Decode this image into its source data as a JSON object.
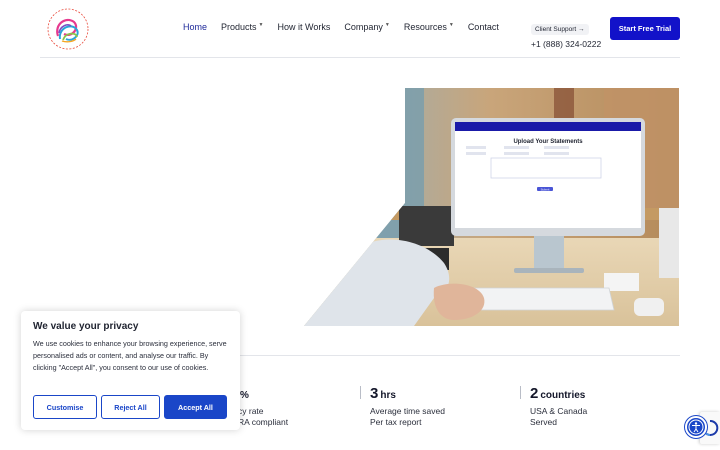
{
  "nav": {
    "items": [
      {
        "label": "Home",
        "has_dropdown": false,
        "active": true
      },
      {
        "label": "Products",
        "has_dropdown": true,
        "active": false
      },
      {
        "label": "How it Works",
        "has_dropdown": false,
        "active": false
      },
      {
        "label": "Company",
        "has_dropdown": true,
        "active": false
      },
      {
        "label": "Resources",
        "has_dropdown": true,
        "active": false
      },
      {
        "label": "Contact",
        "has_dropdown": false,
        "active": false
      }
    ]
  },
  "support": {
    "label": "Client Support",
    "arrow": "→",
    "phone": "+1 (888) 324-0222"
  },
  "cta": {
    "label": "Start Free Trial"
  },
  "hero_screen": {
    "heading": "Upload Your Statements",
    "button_label": "Submit"
  },
  "stats": [
    {
      "num": "",
      "unit": "%",
      "line1": "cy rate",
      "line2": "RA compliant"
    },
    {
      "num": "3",
      "unit": "hrs",
      "line1": "Average time saved",
      "line2": "Per tax report"
    },
    {
      "num": "2",
      "unit": "countries",
      "line1": "USA & Canada",
      "line2": "Served"
    }
  ],
  "cookie": {
    "title": "We value your privacy",
    "text": "We use cookies to enhance your browsing experience, serve personalised ads or content, and analyse our traffic. By clicking \"Accept All\", you consent to our use of cookies.",
    "customise": "Customise",
    "reject": "Reject All",
    "accept": "Accept All"
  },
  "colors": {
    "brand_blue": "#1212c9",
    "cookie_blue": "#1a46c8",
    "nav_active": "#1f2a9a"
  },
  "icons": {
    "logo": "swirl-logo",
    "accessibility": "accessibility-icon",
    "recaptcha": "recaptcha-icon"
  }
}
